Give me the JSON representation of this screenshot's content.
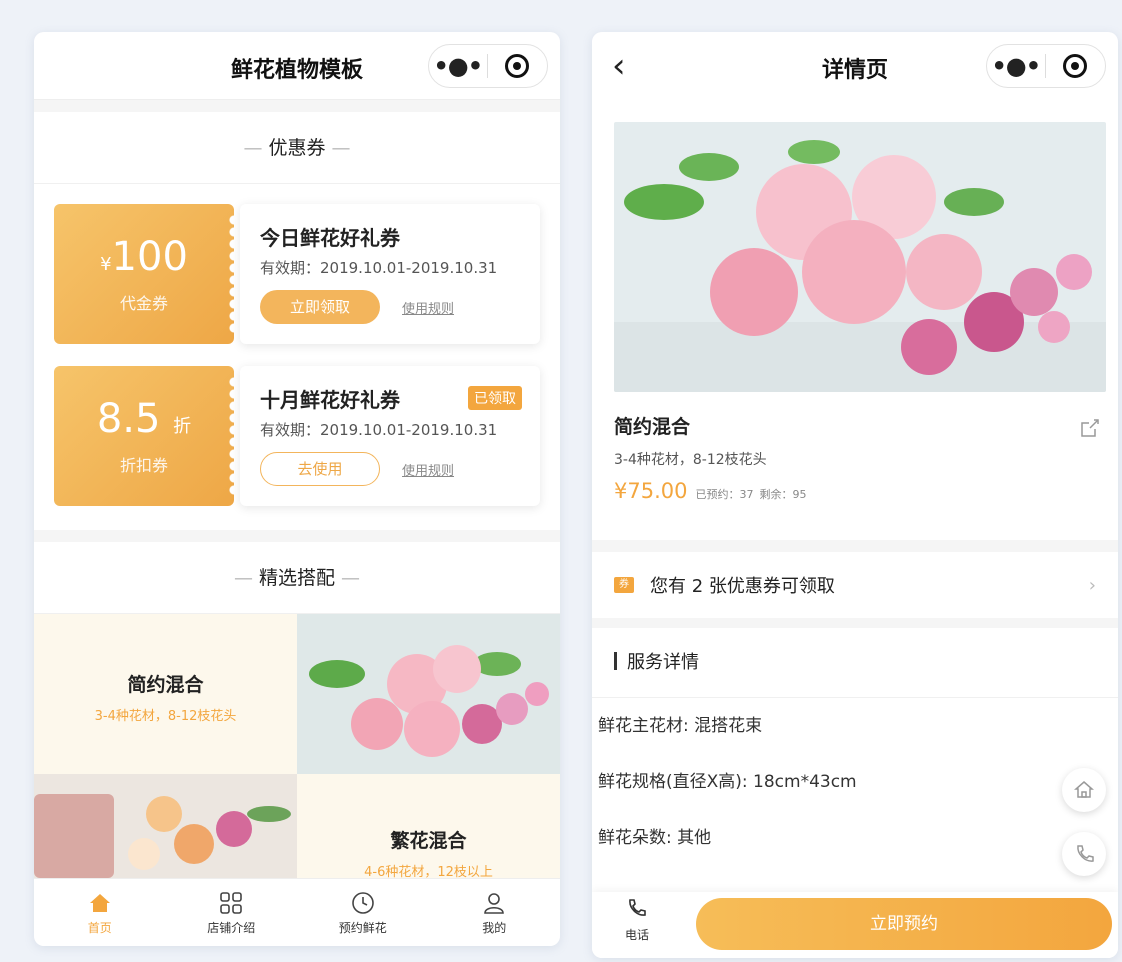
{
  "left": {
    "nav_title": "鲜花植物模板",
    "coupon_section_title": "优惠券",
    "coupons": [
      {
        "currency": "¥",
        "amount": "100",
        "unit": "",
        "type": "代金券",
        "name": "今日鲜花好礼券",
        "validity": "有效期：2019.10.01-2019.10.31",
        "action": "立即领取",
        "rule": "使用规则",
        "badge": ""
      },
      {
        "currency": "",
        "amount": "8.5",
        "unit": "折",
        "type": "折扣券",
        "name": "十月鲜花好礼券",
        "validity": "有效期：2019.10.01-2019.10.31",
        "action": "去使用",
        "rule": "使用规则",
        "badge": "已领取"
      }
    ],
    "pick_section_title": "精选搭配",
    "picks": [
      {
        "name": "简约混合",
        "desc": "3-4种花材，8-12枝花头"
      },
      {
        "name": "繁花混合",
        "desc": "4-6种花材，12枝以上"
      }
    ],
    "tabs": [
      {
        "label": "首页",
        "icon": "home-icon"
      },
      {
        "label": "店铺介绍",
        "icon": "grid-icon"
      },
      {
        "label": "预约鲜花",
        "icon": "clock-icon"
      },
      {
        "label": "我的",
        "icon": "user-icon"
      }
    ]
  },
  "right": {
    "nav_title": "详情页",
    "product": {
      "name": "简约混合",
      "spec": "3-4种花材，8-12枝花头",
      "price": "¥75.00",
      "booked": "已预约：37",
      "remaining": "剩余：95"
    },
    "coupon_tag": "券",
    "coupon_text": "您有 2 张优惠券可领取",
    "service_title": "服务详情",
    "service_lines": [
      "鲜花主花材: 混搭花束",
      "鲜花规格(直径X高): 18cm*43cm",
      "鲜花朵数: 其他"
    ],
    "call_label": "电话",
    "book_label": "立即预约"
  },
  "colors": {
    "accent": "#f3a63e",
    "accent_light": "#f6c46a",
    "background": "#f5f5f5"
  }
}
